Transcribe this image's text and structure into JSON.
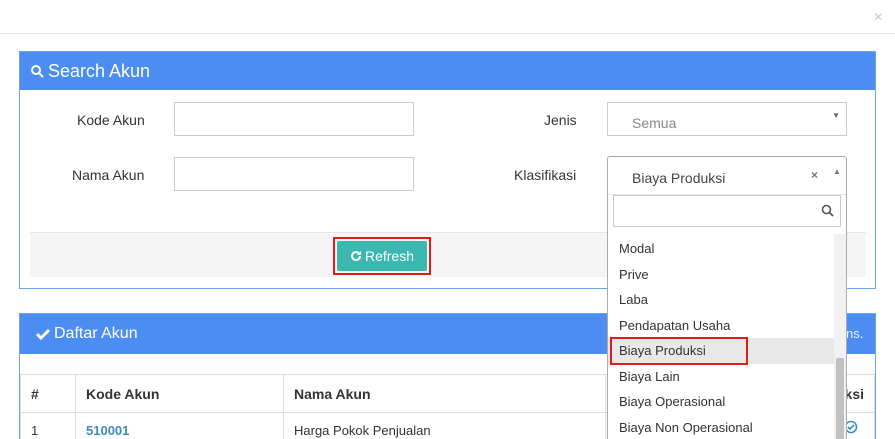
{
  "modal": {
    "close_symbol": "×"
  },
  "search_panel": {
    "title": "Search Akun",
    "fields": {
      "kode_akun_label": "Kode Akun",
      "kode_akun_value": "",
      "nama_akun_label": "Nama Akun",
      "nama_akun_value": "",
      "jenis_label": "Jenis",
      "jenis_value": "Semua",
      "klasifikasi_label": "Klasifikasi",
      "klasifikasi_value": "Biaya Produksi"
    },
    "refresh_label": "Refresh"
  },
  "daftar_panel": {
    "title": "Daftar Akun",
    "header_extra": "ns.",
    "columns": [
      "#",
      "Kode Akun",
      "Nama Akun",
      "ksi"
    ],
    "rows": [
      {
        "no": "1",
        "kode": "510001",
        "nama": "Harga Pokok Penjualan"
      }
    ]
  },
  "dropdown": {
    "selected": "Biaya Produksi",
    "clear_symbol": "×",
    "search_value": "",
    "options": [
      "Modal",
      "Prive",
      "Laba",
      "Pendapatan Usaha",
      "Biaya Produksi",
      "Biaya Lain",
      "Biaya Operasional",
      "Biaya Non Operasional"
    ]
  },
  "colors": {
    "panel_header": "#4b8df0",
    "refresh_button": "#3ab8b0",
    "highlight": "#e11a1a",
    "link": "#3c8dbc"
  }
}
